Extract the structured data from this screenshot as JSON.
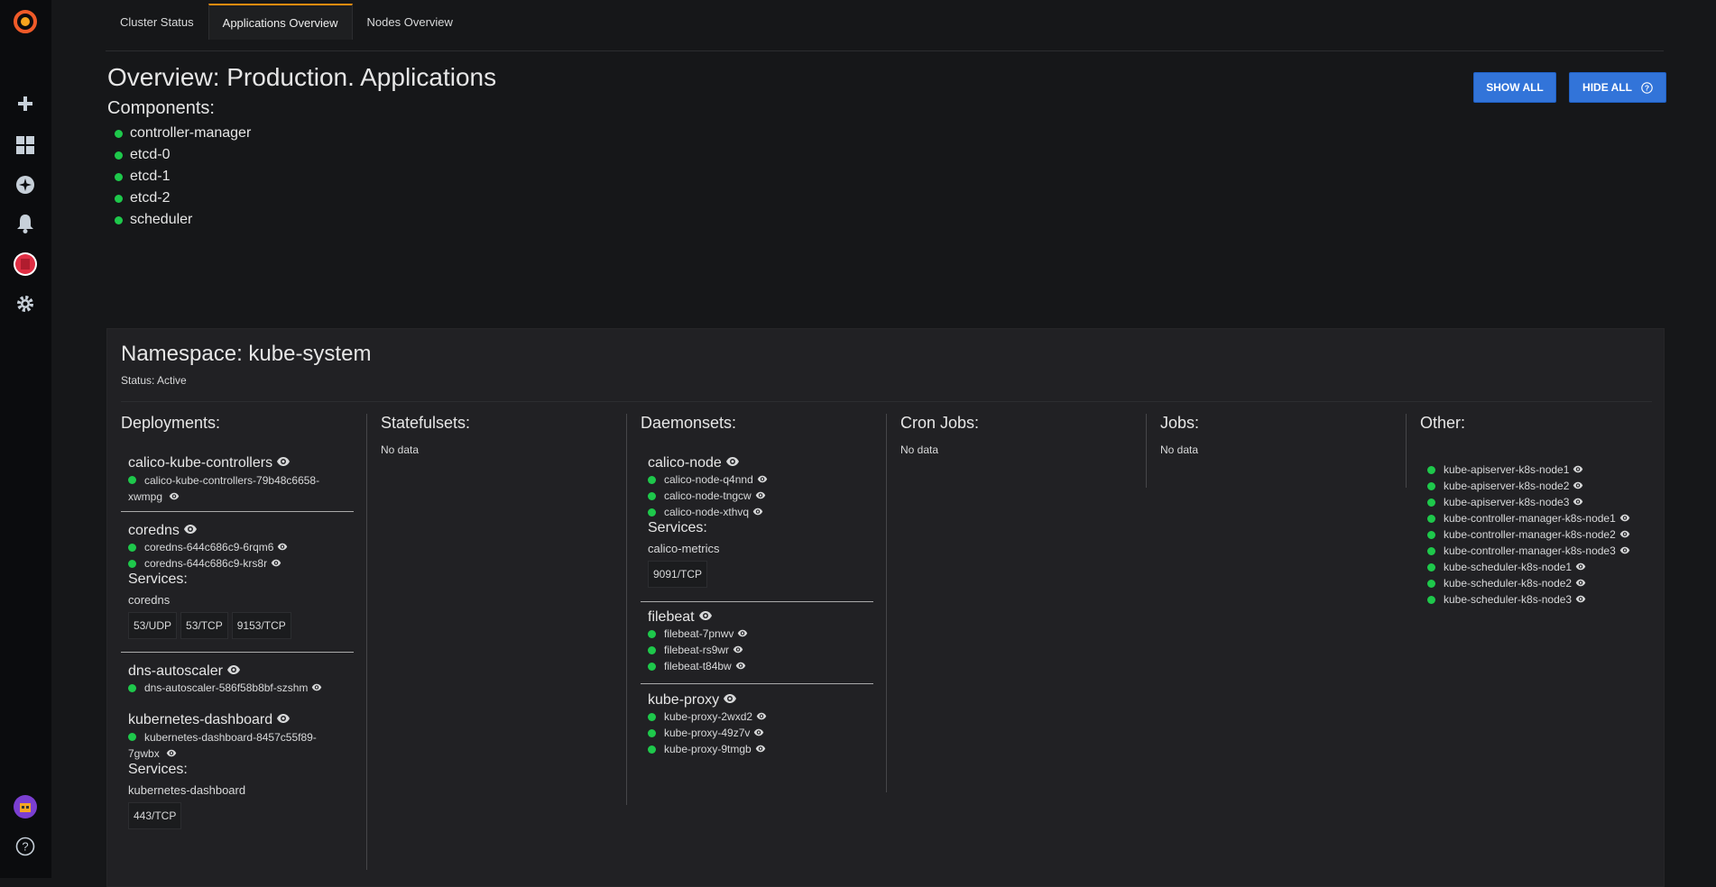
{
  "tabs": [
    "Cluster Status",
    "Applications Overview",
    "Nodes Overview"
  ],
  "overview_title": "Overview: Production. Applications",
  "components_title": "Components:",
  "components": [
    "controller-manager",
    "etcd-0",
    "etcd-1",
    "etcd-2",
    "scheduler"
  ],
  "buttons": {
    "show_all": "SHOW ALL",
    "hide_all": "HIDE ALL"
  },
  "namespace": {
    "title": "Namespace: kube-system",
    "status": "Status: Active"
  },
  "columns": {
    "deployments": "Deployments:",
    "statefulsets": "Statefulsets:",
    "daemonsets": "Daemonsets:",
    "cronjobs": "Cron Jobs:",
    "jobs": "Jobs:",
    "other": "Other:"
  },
  "no_data": "No data",
  "services_label": "Services:",
  "deployments": [
    {
      "name": "calico-kube-controllers",
      "pods": [
        "calico-kube-controllers-79b48c6658-xwmpg"
      ]
    },
    {
      "name": "coredns",
      "pods": [
        "coredns-644c686c9-6rqm6",
        "coredns-644c686c9-krs8r"
      ],
      "service": "coredns",
      "ports": [
        "53/UDP",
        "53/TCP",
        "9153/TCP"
      ]
    },
    {
      "name": "dns-autoscaler",
      "pods": [
        "dns-autoscaler-586f58b8bf-szshm"
      ]
    },
    {
      "name": "kubernetes-dashboard",
      "pods": [
        "kubernetes-dashboard-8457c55f89-7gwbx"
      ],
      "service": "kubernetes-dashboard",
      "ports": [
        "443/TCP"
      ]
    }
  ],
  "daemonsets": [
    {
      "name": "calico-node",
      "pods": [
        "calico-node-q4nnd",
        "calico-node-tngcw",
        "calico-node-xthvq"
      ],
      "service": "calico-metrics",
      "ports": [
        "9091/TCP"
      ]
    },
    {
      "name": "filebeat",
      "pods": [
        "filebeat-7pnwv",
        "filebeat-rs9wr",
        "filebeat-t84bw"
      ]
    },
    {
      "name": "kube-proxy",
      "pods": [
        "kube-proxy-2wxd2",
        "kube-proxy-49z7v",
        "kube-proxy-9tmgb"
      ]
    }
  ],
  "other": [
    "kube-apiserver-k8s-node1",
    "kube-apiserver-k8s-node2",
    "kube-apiserver-k8s-node3",
    "kube-controller-manager-k8s-node1",
    "kube-controller-manager-k8s-node2",
    "kube-controller-manager-k8s-node3",
    "kube-scheduler-k8s-node1",
    "kube-scheduler-k8s-node2",
    "kube-scheduler-k8s-node3"
  ],
  "colors": {
    "accent": "#3274d9",
    "ok": "#1ec84b",
    "tab_active": "#f28c0f"
  }
}
